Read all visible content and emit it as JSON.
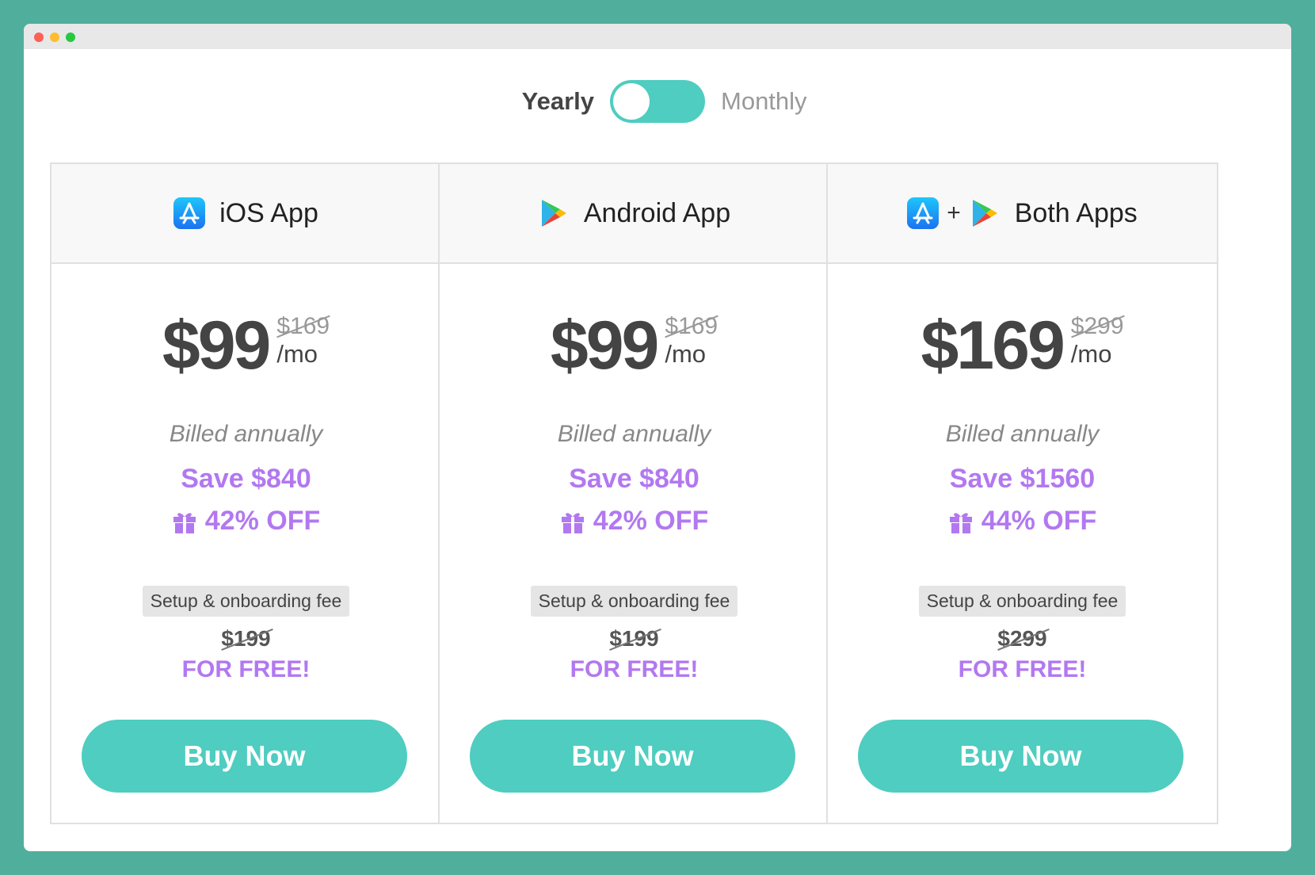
{
  "toggle": {
    "left_label": "Yearly",
    "right_label": "Monthly",
    "state": "Yearly",
    "accent_color": "#4ecdc0"
  },
  "plans": [
    {
      "name": "iOS App",
      "icons": [
        "app-store-icon"
      ],
      "price": "$99",
      "old_price": "$169",
      "unit": "/mo",
      "billing": "Billed annually",
      "save": "Save $840",
      "discount": "42% OFF",
      "fee_label": "Setup & onboarding fee",
      "fee_old": "$199",
      "fee_free": "FOR FREE!",
      "button": "Buy Now"
    },
    {
      "name": "Android App",
      "icons": [
        "google-play-icon"
      ],
      "price": "$99",
      "old_price": "$169",
      "unit": "/mo",
      "billing": "Billed annually",
      "save": "Save $840",
      "discount": "42% OFF",
      "fee_label": "Setup & onboarding fee",
      "fee_old": "$199",
      "fee_free": "FOR FREE!",
      "button": "Buy Now"
    },
    {
      "name": "Both Apps",
      "plus": "+",
      "icons": [
        "app-store-icon",
        "google-play-icon"
      ],
      "price": "$169",
      "old_price": "$299",
      "unit": "/mo",
      "billing": "Billed annually",
      "save": "Save $1560",
      "discount": "44% OFF",
      "fee_label": "Setup & onboarding fee",
      "fee_old": "$299",
      "fee_free": "FOR FREE!",
      "button": "Buy Now"
    }
  ],
  "colors": {
    "background": "#50ae9c",
    "accent": "#4ecdc0",
    "highlight": "#b278f0",
    "price_text": "#444444"
  }
}
